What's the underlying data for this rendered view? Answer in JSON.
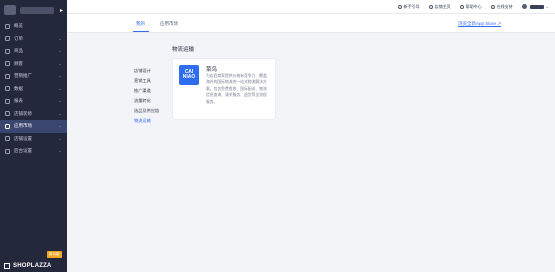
{
  "sidebar": {
    "items": [
      {
        "label": "概览",
        "has_chevron": false
      },
      {
        "label": "订单",
        "has_chevron": true
      },
      {
        "label": "商品",
        "has_chevron": true
      },
      {
        "label": "顾客",
        "has_chevron": true
      },
      {
        "label": "营销推广",
        "has_chevron": true
      },
      {
        "label": "数据",
        "has_chevron": true
      },
      {
        "label": "报表",
        "has_chevron": true
      },
      {
        "label": "店铺装修",
        "has_chevron": true
      },
      {
        "label": "应用市场",
        "has_chevron": true,
        "active": true
      },
      {
        "label": "店铺设置",
        "has_chevron": true
      },
      {
        "label": "后台设置",
        "has_chevron": true
      }
    ],
    "brand": "SHOPLAZZA",
    "badge": "新功能"
  },
  "topbar": {
    "items": [
      "新手引导",
      "店铺主页",
      "帮助中心",
      "在线支持"
    ]
  },
  "tabs": {
    "items": [
      "我的",
      "应用市场"
    ],
    "active_index": 0,
    "store_link": "浏览全新App Store ↗"
  },
  "main": {
    "section_title": "物流运输",
    "categories": [
      "店铺设计",
      "营销工具",
      "推广渠道",
      "流量转化",
      "选品及供应链",
      "物流运输"
    ],
    "active_category": "物流运输",
    "app": {
      "icon_text_1": "CAI",
      "icon_text_2": "NIAO",
      "title": "菜鸟",
      "description": "为店匠商家提供价格有竞争力、覆盖海外的国际物流的一站式物流解决方案。包含免费揽收、国际配送、物流信息查询、清关服务、退货等全流程服务。"
    }
  },
  "colors": {
    "accent": "#356af3",
    "sidebar_bg": "#24283b",
    "sidebar_active": "#3a4670"
  }
}
